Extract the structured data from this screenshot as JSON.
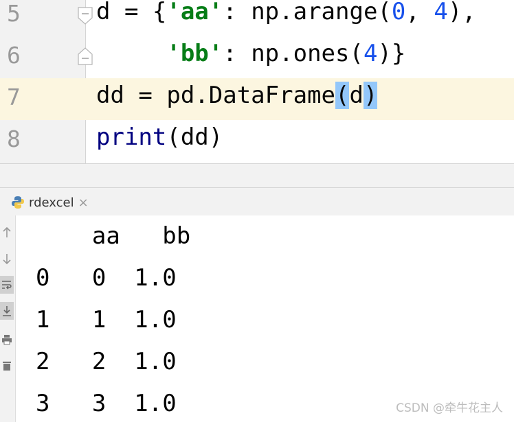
{
  "editor": {
    "lines": [
      {
        "number": "5"
      },
      {
        "number": "6"
      },
      {
        "number": "7"
      },
      {
        "number": "8"
      }
    ]
  },
  "run_tab": {
    "label": "rdexcel",
    "close_glyph": "×"
  },
  "console": {
    "header": "    aa   bb",
    "rows": [
      "0   0  1.0",
      "1   1  1.0",
      "2   2  1.0",
      "3   3  1.0"
    ]
  },
  "watermark": "CSDN @牵牛花主人",
  "colors": {
    "string": "#067d17",
    "number": "#1750eb",
    "builtin": "#000080",
    "current_line": "#fcf6e0",
    "brace_highlight": "#93c7fa"
  },
  "icons": [
    "fold-start-icon",
    "fold-end-icon",
    "python-file-icon",
    "close-icon",
    "up-arrow-icon",
    "down-arrow-icon",
    "soft-wrap-icon",
    "scroll-to-end-icon",
    "print-icon",
    "trash-icon"
  ]
}
